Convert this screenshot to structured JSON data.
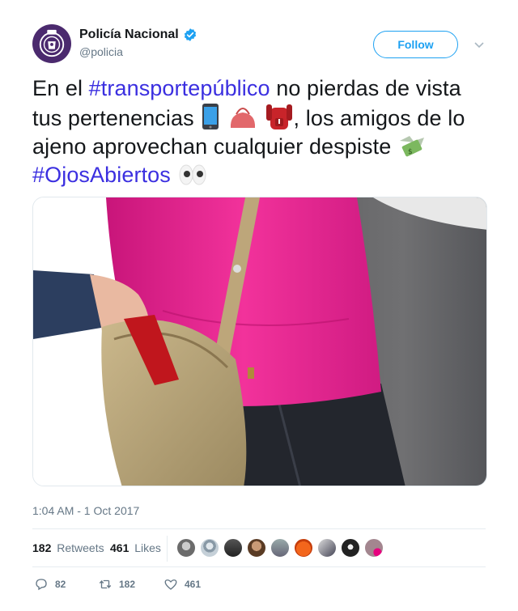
{
  "user": {
    "display_name": "Policía Nacional",
    "handle": "@policia",
    "verified": true,
    "avatar_icon": "police-badge-icon"
  },
  "follow_label": "Follow",
  "tweet": {
    "text_1": "En el ",
    "hashtag_1": "#transportepúblico",
    "text_2": " no pierdas de vista tus pertenencias ",
    "text_3": ", los amigos de lo ajeno aprovechan cualquier despiste ",
    "hashtag_2": "#OjosAbiertos",
    "emojis": [
      "mobile-phone-icon",
      "handbag-icon",
      "backpack-icon",
      "money-with-wings-icon",
      "eyes-icon"
    ]
  },
  "media": {
    "description_icon": "photo-pickpocket-bag"
  },
  "timestamp": "1:04 AM - 1 Oct 2017",
  "stats": {
    "retweets_count": "182",
    "retweets_label": "Retweets",
    "likes_count": "461",
    "likes_label": "Likes"
  },
  "actions": {
    "replies": "82",
    "retweets": "182",
    "likes": "461"
  },
  "colors": {
    "link": "#1da1f2",
    "hashtag": "#3b2fe0",
    "avatar_bg": "#4b2a6e"
  }
}
